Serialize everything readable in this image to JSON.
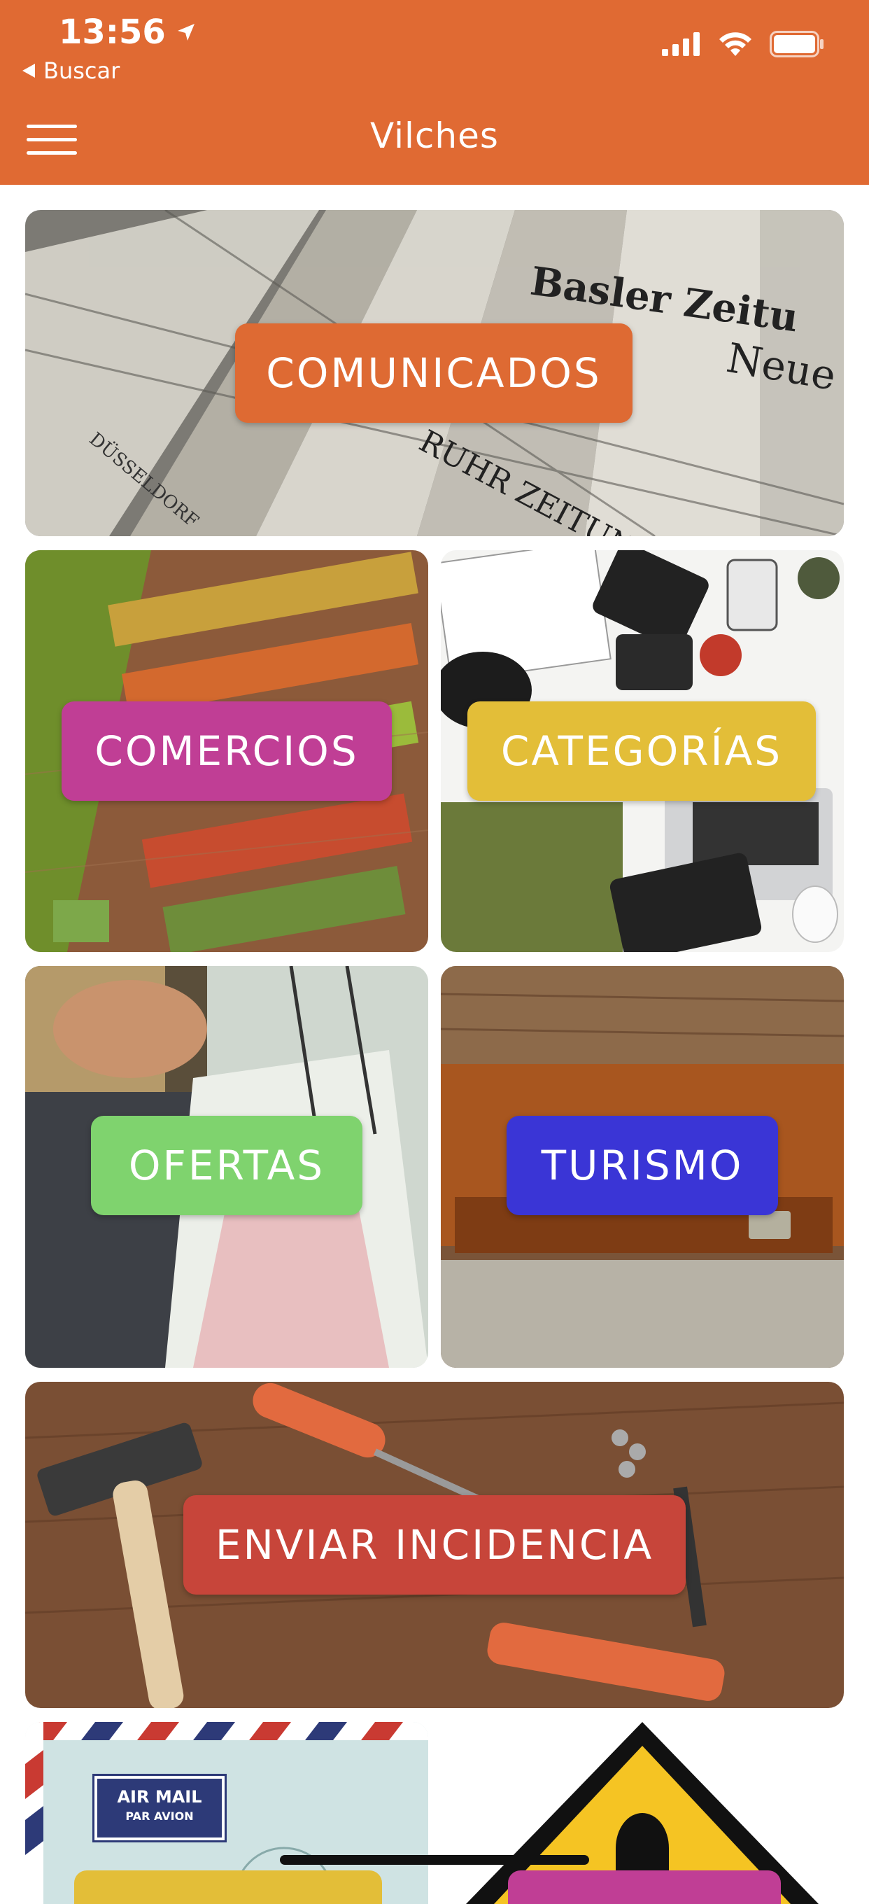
{
  "status_bar": {
    "time": "13:56"
  },
  "nav": {
    "back_label": "Buscar",
    "title": "Vilches"
  },
  "tiles": {
    "comunicados": {
      "label": "COMUNICADOS",
      "color": "#DE6A33"
    },
    "comercios": {
      "label": "COMERCIOS",
      "color": "#C03E95"
    },
    "categorias": {
      "label": "CATEGORÍAS",
      "color": "#E3BE38"
    },
    "ofertas": {
      "label": "OFERTAS",
      "color": "#7FD36E"
    },
    "turismo": {
      "label": "TURISMO",
      "color": "#3A35D6"
    },
    "incidencia": {
      "label": "ENVIAR INCIDENCIA",
      "color": "#C7453A"
    },
    "airmail": {
      "stamp_line1": "AIR MAIL",
      "stamp_line2": "PAR AVION"
    }
  },
  "colors": {
    "header": "#E06A33",
    "background": "#FFFFFF"
  }
}
